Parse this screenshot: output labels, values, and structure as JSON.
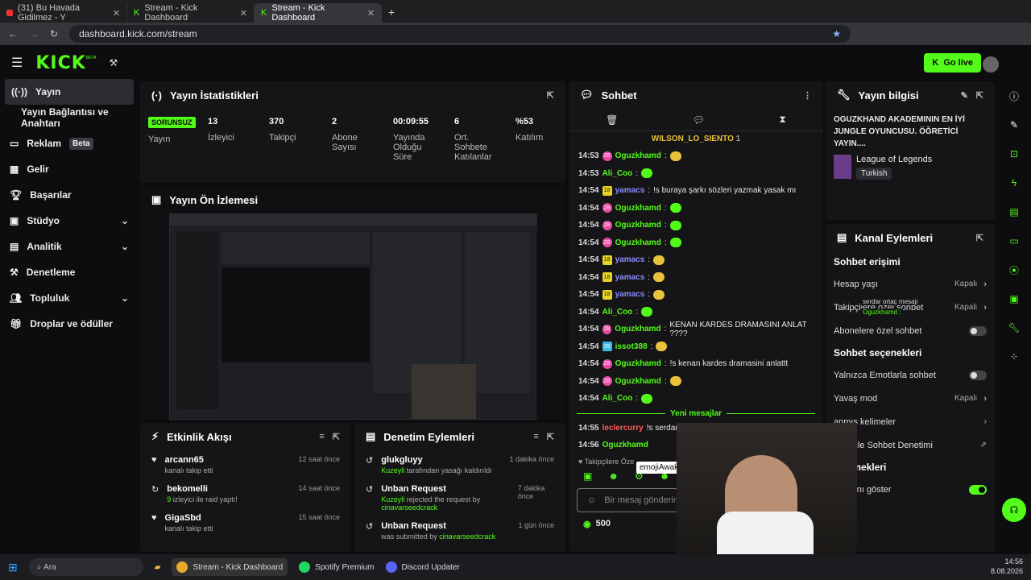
{
  "browser": {
    "tabs": [
      {
        "label": "(31) Bu Havada Gidilmez - Y"
      },
      {
        "label": "Stream - Kick Dashboard"
      },
      {
        "label": "Stream - Kick Dashboard"
      }
    ],
    "url": "dashboard.kick.com/stream"
  },
  "header": {
    "logo": "KICK",
    "beta": "BETA",
    "go_live": "Go live"
  },
  "sidebar": {
    "items": [
      {
        "label": "Yayın"
      },
      {
        "label": "Yayın Bağlantısı ve Anahtarı"
      },
      {
        "label": "Reklam",
        "badge": "Beta"
      },
      {
        "label": "Gelir"
      },
      {
        "label": "Başarılar"
      },
      {
        "label": "Stüdyo"
      },
      {
        "label": "Analitik"
      },
      {
        "label": "Denetleme"
      },
      {
        "label": "Topluluk"
      },
      {
        "label": "Droplar ve ödüller"
      }
    ]
  },
  "stats": {
    "title": "Yayın İstatistikleri",
    "status": "SORUNSUZ",
    "status_label": "Yayın",
    "items": [
      {
        "value": "13",
        "label": "İzleyici"
      },
      {
        "value": "370",
        "label": "Takipçi"
      },
      {
        "value": "2",
        "label": "Abone Sayısı"
      },
      {
        "value": "00:09:55",
        "label": "Yayında Olduğu Süre"
      },
      {
        "value": "6",
        "label": "Ort. Sohbete Katılanlar"
      },
      {
        "value": "%53",
        "label": "Katılım"
      }
    ]
  },
  "preview": {
    "title": "Yayın Ön İzlemesi"
  },
  "activity": {
    "title": "Etkinlik Akışı",
    "items": [
      {
        "name": "arcann65",
        "sub": "kanalı takip etti",
        "time": "12 saat önce"
      },
      {
        "name": "bekomelli",
        "sub_count": "9",
        "sub": " izleyici ile raid yaptı!",
        "time": "14 saat önce"
      },
      {
        "name": "GigaSbd",
        "sub": "kanalı takip etti",
        "time": "15 saat önce"
      }
    ]
  },
  "moderation": {
    "title": "Denetim Eylemleri",
    "items": [
      {
        "name": "glukgluyy",
        "actor": "Kuzeyli",
        "sub": " tarafından yasağı kaldırıldı",
        "time": "1 dakika önce"
      },
      {
        "name": "Unban Request",
        "actor": "Kuzeyli",
        "sub": " rejected the request by ",
        "target": "cinavarseedcrack",
        "time": "7 dakika önce"
      },
      {
        "name": "Unban Request",
        "actor": "",
        "sub": "was submitted by ",
        "target": "cinavarseedcrack",
        "time": "1 gün önce"
      }
    ]
  },
  "chat": {
    "title": "Sohbet",
    "pinned_user": "WILSON_LO_SIENTO",
    "pinned_count": "1",
    "messages": [
      {
        "time": "14:53",
        "lvl": "28",
        "user": "Oguzkhamd",
        "color": "#53fc18",
        "text": "",
        "emote": "y"
      },
      {
        "time": "14:53",
        "lvl": "",
        "user": "Ali_Coo",
        "color": "#53fc18",
        "text": "",
        "emote": "g"
      },
      {
        "time": "14:54",
        "lvl": "18",
        "user": "yamacs",
        "color": "#8a8cff",
        "text": "!s buraya şarkı sözleri yazmak yasak mı",
        "emote": ""
      },
      {
        "time": "14:54",
        "lvl": "28",
        "user": "Oguzkhamd",
        "color": "#53fc18",
        "text": "",
        "emote": "g"
      },
      {
        "time": "14:54",
        "lvl": "28",
        "user": "Oguzkhamd",
        "color": "#53fc18",
        "text": "",
        "emote": "g"
      },
      {
        "time": "14:54",
        "lvl": "28",
        "user": "Oguzkhamd",
        "color": "#53fc18",
        "text": "",
        "emote": "g"
      },
      {
        "time": "14:54",
        "lvl": "18",
        "user": "yamacs",
        "color": "#8a8cff",
        "text": "",
        "emote": "y"
      },
      {
        "time": "14:54",
        "lvl": "18",
        "user": "yamacs",
        "color": "#8a8cff",
        "text": "",
        "emote": "y"
      },
      {
        "time": "14:54",
        "lvl": "18",
        "user": "yamacs",
        "color": "#8a8cff",
        "text": "",
        "emote": "y"
      },
      {
        "time": "14:54",
        "lvl": "",
        "user": "Ali_Coo",
        "color": "#53fc18",
        "text": "",
        "emote": "g"
      },
      {
        "time": "14:54",
        "lvl": "28",
        "user": "Oguzkhamd",
        "color": "#53fc18",
        "text": "KENAN KARDES DRAMASINI ANLAT ????",
        "emote": ""
      },
      {
        "time": "14:54",
        "lvl": "39",
        "user": "issot388",
        "color": "#53fc18",
        "text": "",
        "emote": "y"
      },
      {
        "time": "14:54",
        "lvl": "28",
        "user": "Oguzkhamd",
        "color": "#53fc18",
        "text": "!s kenan kardes dramasini anlattt",
        "emote": ""
      },
      {
        "time": "14:54",
        "lvl": "28",
        "user": "Oguzkhamd",
        "color": "#53fc18",
        "text": "",
        "emote": "y"
      },
      {
        "time": "14:54",
        "lvl": "",
        "user": "Ali_Coo",
        "color": "#53fc18",
        "text": "",
        "emote": "g"
      }
    ],
    "new_messages": "Yeni mesajlar",
    "after": [
      {
        "time": "14:55",
        "user": "leclercurry",
        "color": "#ff5a5a",
        "text": "!s serdar"
      },
      {
        "time": "14:56",
        "user": "Oguzkhamd",
        "color": "#53fc18",
        "text": ""
      }
    ],
    "followers_only": "Takipçilere Öze",
    "tooltip": "emojiAwak",
    "placeholder": "Bir mesaj gönderin",
    "points": "500"
  },
  "info": {
    "title": "Yayın bilgisi",
    "stream_title": "OGUZKHAND AKADEMININ EN İYİ JUNGLE OYUNCUSU. ÖĞRETİCİ YAYIN....",
    "category": "League of Legends",
    "language": "Turkish"
  },
  "actions": {
    "title": "Kanal Eylemleri",
    "access": "Sohbet erişimi",
    "rows": [
      {
        "label": "Hesap yaşı",
        "value": "Kapalı"
      },
      {
        "label": "Takipçilere özel sohbet",
        "value": "Kapalı"
      },
      {
        "label": "Abonelere özel sohbet"
      }
    ],
    "options": "Sohbet seçenekleri",
    "rows2": [
      {
        "label": "Yalnızca Emotlarla sohbet"
      },
      {
        "label": "Yavaş mod",
        "value": "Kapalı"
      },
      {
        "label": "anmış kelimeler"
      },
      {
        "label": "Zeka ile Sohbet Denetimi"
      }
    ],
    "more": "seçenekleri",
    "rows3": [
      {
        "label": "sayısını göster"
      },
      {
        "label": "anal"
      }
    ],
    "overlay_text": "serdar ortaç mesajı",
    "overlay_user": "Oguzkhamd :"
  },
  "taskbar": {
    "search": "Ara",
    "apps": [
      {
        "label": "Stream - Kick Dashboard"
      },
      {
        "label": "Spotify Premium"
      },
      {
        "label": "Discord Updater"
      }
    ],
    "time": "14:56",
    "date": "8.08.2026"
  },
  "colors": {
    "accent": "#53fc18",
    "panel": "#151518"
  }
}
